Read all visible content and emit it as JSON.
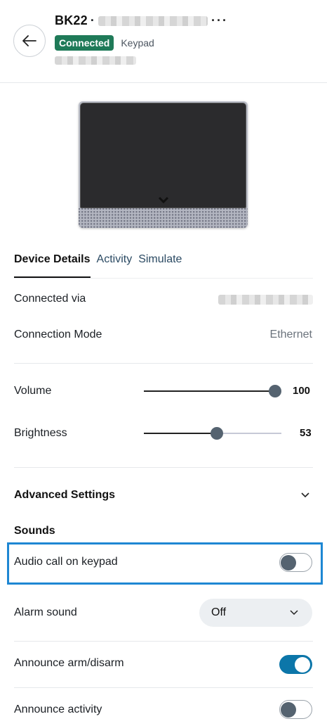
{
  "header": {
    "device_name": "BK22",
    "separator": "·",
    "more_label": "···",
    "status": "Connected",
    "device_type": "Keypad"
  },
  "tabs": [
    {
      "label": "Device Details",
      "active": true
    },
    {
      "label": "Activity",
      "active": false
    },
    {
      "label": "Simulate",
      "active": false
    }
  ],
  "details": {
    "connected_via_label": "Connected via",
    "connection_mode_label": "Connection Mode",
    "connection_mode_value": "Ethernet"
  },
  "sliders": {
    "volume": {
      "label": "Volume",
      "value": 100,
      "display": "100",
      "max": 100
    },
    "brightness": {
      "label": "Brightness",
      "value": 53,
      "display": "53",
      "max": 100
    }
  },
  "advanced": {
    "label": "Advanced Settings"
  },
  "sounds": {
    "section_label": "Sounds",
    "audio_call": {
      "label": "Audio call on keypad",
      "on": false
    },
    "alarm_sound": {
      "label": "Alarm sound",
      "value": "Off"
    },
    "announce_arm": {
      "label": "Announce arm/disarm",
      "on": true
    },
    "announce_activity": {
      "label": "Announce activity",
      "on": false
    }
  },
  "colors": {
    "connected_badge": "#1f7a58",
    "toggle_on": "#0c76a9",
    "highlight": "#1e87d3"
  },
  "icons": {
    "back": "arrow-left-icon",
    "more": "ellipsis-icon",
    "advanced": "chevron-down-icon",
    "select": "chevron-down-icon"
  }
}
